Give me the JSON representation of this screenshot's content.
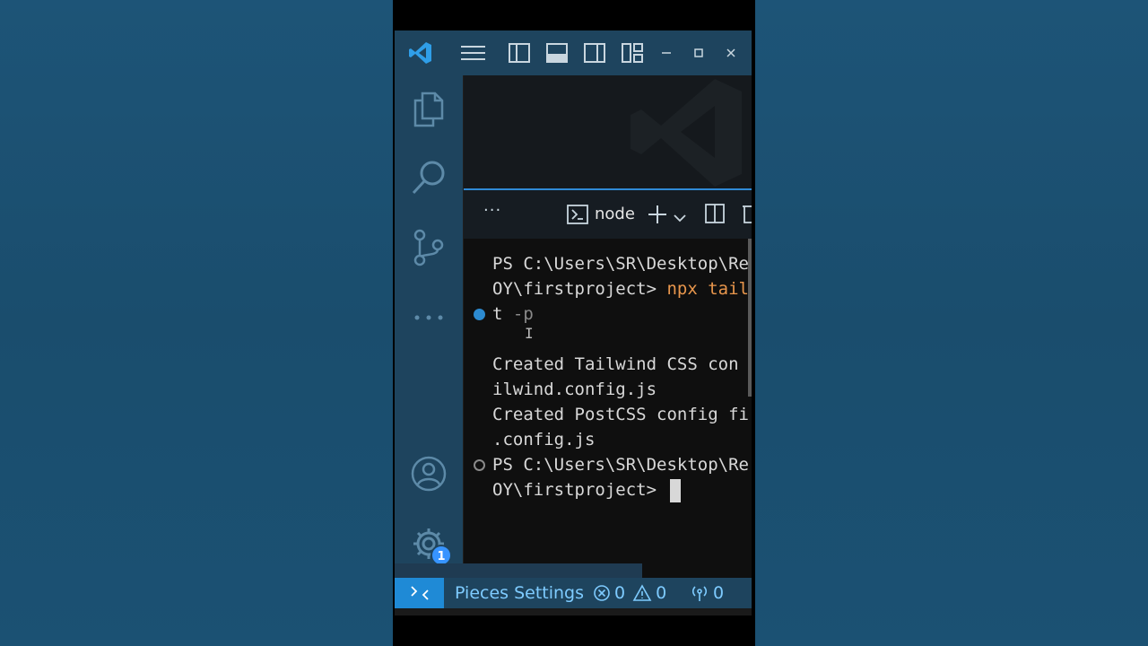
{
  "panel": {
    "more_label": "···",
    "terminal_profile": "node"
  },
  "terminal": {
    "lines": [
      "PS C:\\Users\\SR\\Desktop\\Re",
      "OY\\firstproject> ",
      "npx tail",
      "t ",
      "-p",
      "Created Tailwind CSS con",
      "ilwind.config.js",
      "Created PostCSS config fi",
      ".config.js",
      "PS C:\\Users\\SR\\Desktop\\Re",
      "OY\\firstproject> "
    ]
  },
  "statusbar": {
    "pieces_label": "Pieces Settings",
    "errors": "0",
    "warnings": "0",
    "ports": "0"
  },
  "activitybar": {
    "settings_badge": "1"
  },
  "colors": {
    "accent": "#2f8ad6",
    "command": "#e8964c",
    "status_text": "#7ecbff"
  }
}
